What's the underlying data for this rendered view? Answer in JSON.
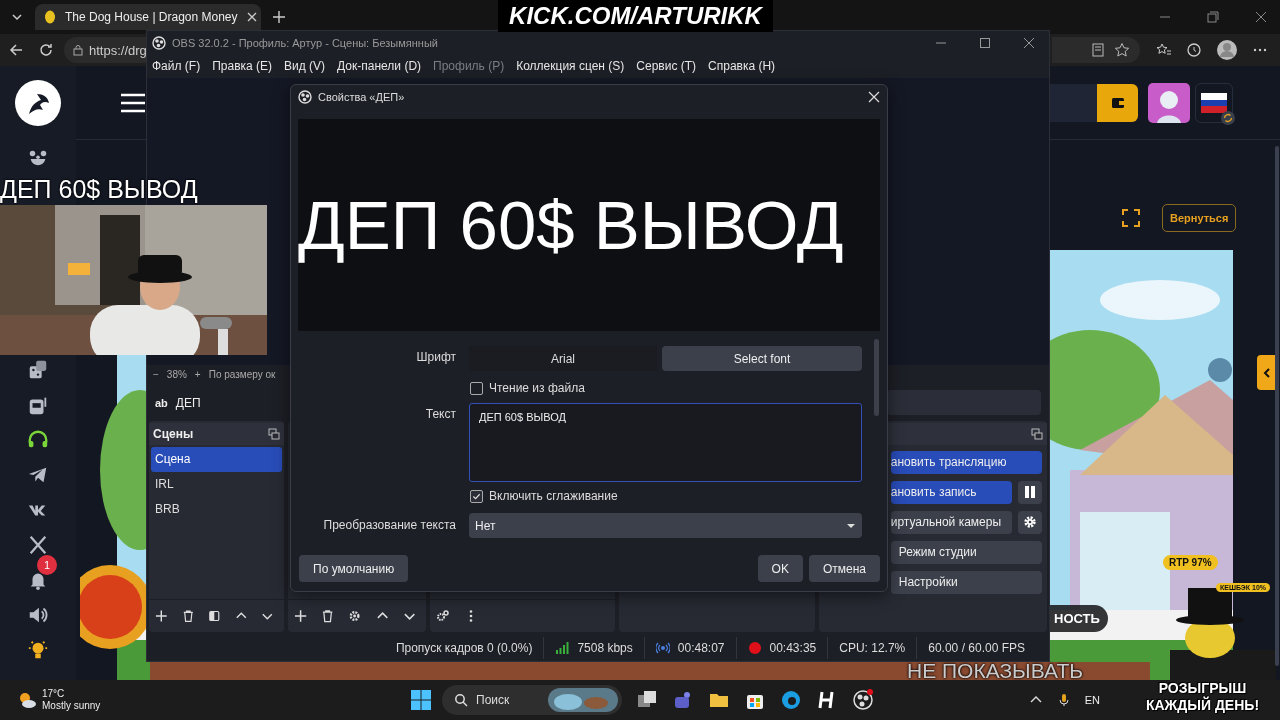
{
  "browser": {
    "tab": {
      "title": "The Dog House | Dragon Money"
    },
    "url": "https://drg"
  },
  "site": {
    "notification_count": "1",
    "back_button": "Вернуться",
    "cut_button": "НОСТЬ",
    "game_badges": [
      "RTP 97%",
      "КЕШБЭК 10%"
    ]
  },
  "obs": {
    "title": "OBS 32.0.2 - Профиль: Артур - Сцены: Безымянный",
    "menu": [
      {
        "label": "Файл (F)",
        "disabled": false
      },
      {
        "label": "Правка (E)",
        "disabled": false
      },
      {
        "label": "Вид (V)",
        "disabled": false
      },
      {
        "label": "Док-панели (D)",
        "disabled": false
      },
      {
        "label": "Профиль (P)",
        "disabled": true
      },
      {
        "label": "Коллекция сцен (S)",
        "disabled": false
      },
      {
        "label": "Сервис (T)",
        "disabled": false
      },
      {
        "label": "Справка (H)",
        "disabled": false
      }
    ],
    "zoom": {
      "minus": "−",
      "value": "38%",
      "plus": "+",
      "fit": "По размеру ок"
    },
    "source": {
      "icon_text": "ab",
      "name": "ДЕП"
    },
    "scenes": {
      "title": "Сцены",
      "items": [
        {
          "name": "Сцена",
          "selected": true
        },
        {
          "name": "IRL",
          "selected": false
        },
        {
          "name": "BRB",
          "selected": false
        }
      ]
    },
    "controls": [
      {
        "label": "ановить трансляцию",
        "active": true,
        "kind": "plain"
      },
      {
        "label": "ановить запись",
        "active": true,
        "kind": "pause"
      },
      {
        "label": "иртуальной камеры",
        "active": false,
        "kind": "settings"
      },
      {
        "label": "Режим студии",
        "active": false,
        "kind": "plain"
      },
      {
        "label": "Настройки",
        "active": false,
        "kind": "plain"
      }
    ],
    "status": {
      "dropped": "Пропуск кадров 0 (0.0%)",
      "bitrate": "7508 kbps",
      "stream_time": "00:48:07",
      "record_time": "00:43:35",
      "cpu": "CPU: 12.7%",
      "fps": "60.00 / 60.00 FPS"
    }
  },
  "dialog": {
    "title": "Свойства «ДЕП»",
    "preview_text": "ДЕП 60$ ВЫВОД",
    "font_label": "Шрифт",
    "font_name": "Arial",
    "select_font": "Select font",
    "read_from_file": {
      "label": "Чтение из файла",
      "checked": false
    },
    "text_label": "Текст",
    "text_value": "ДЕП 60$ ВЫВОД",
    "antialias": {
      "label": "Включить сглаживание",
      "checked": true
    },
    "transform_label": "Преобразование текста",
    "transform_value": "Нет",
    "defaults_button": "По умолчанию",
    "ok_button": "OK",
    "cancel_button": "Отмена"
  },
  "stream_overlay": {
    "channel": "KICK.COM/ARTURIKK",
    "caption": "ДЕП 60$ ВЫВОД",
    "bottom_caption": "НЕ ПОКАЗЫВАТЬ",
    "promo": [
      "РОЗЫГРЫШ",
      "КАЖДЫЙ ДЕНЬ!"
    ]
  },
  "taskbar": {
    "temperature": "17°C",
    "weather": "Mostly sunny",
    "search_placeholder": "Поиск",
    "language": "EN"
  }
}
